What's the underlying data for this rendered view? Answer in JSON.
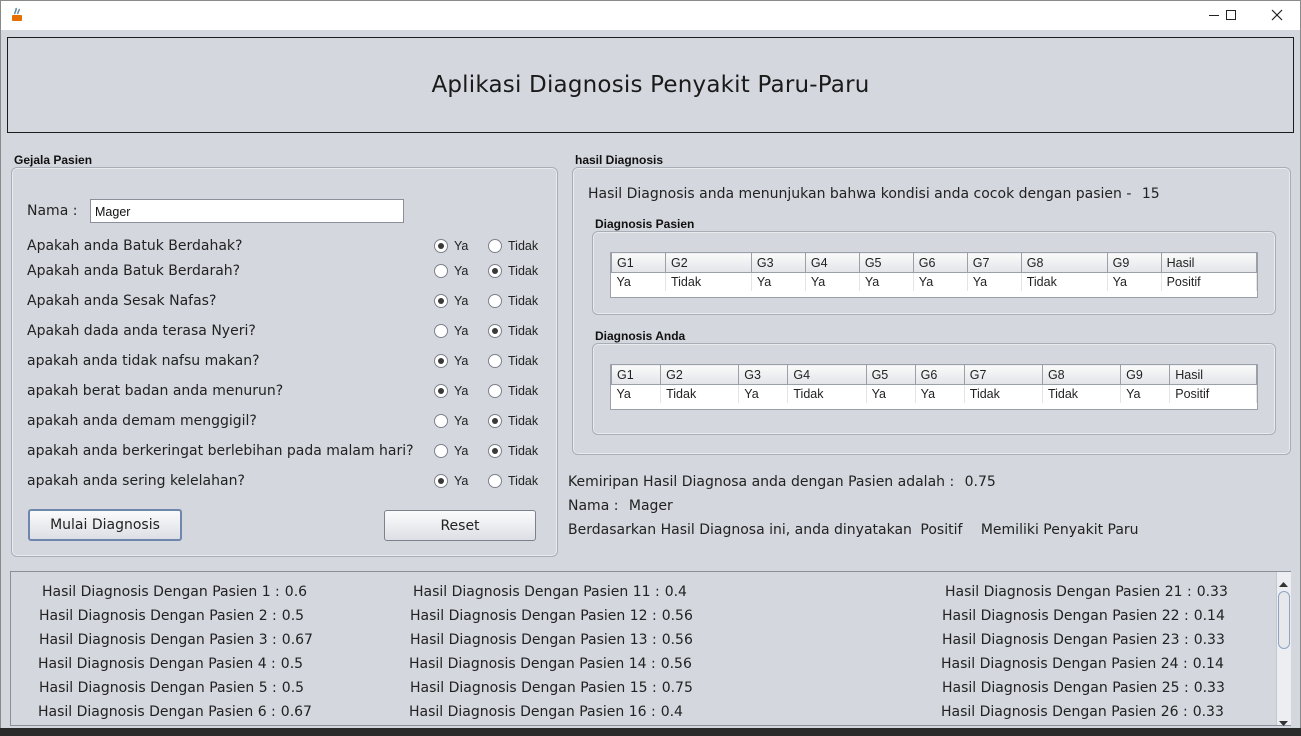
{
  "window": {
    "close_glyph": "✕"
  },
  "header": {
    "title": "Aplikasi Diagnosis Penyakit Paru-Paru"
  },
  "symptoms": {
    "group_title": "Gejala Pasien",
    "name_label": "Nama :",
    "name_value": "Mager",
    "yes_label": "Ya",
    "no_label": "Tidak",
    "questions": [
      {
        "text": "Apakah anda Batuk Berdahak?",
        "answer": "Ya"
      },
      {
        "text": "Apakah anda Batuk Berdarah?",
        "answer": "Tidak"
      },
      {
        "text": "Apakah anda Sesak Nafas?",
        "answer": "Ya"
      },
      {
        "text": "Apakah dada anda terasa Nyeri?",
        "answer": "Tidak"
      },
      {
        "text": "apakah anda tidak nafsu makan?",
        "answer": "Ya"
      },
      {
        "text": "apakah berat badan anda menurun?",
        "answer": "Ya"
      },
      {
        "text": "apakah anda demam menggigil?",
        "answer": "Tidak"
      },
      {
        "text": "apakah anda berkeringat berlebihan pada malam hari?",
        "answer": "Tidak"
      },
      {
        "text": "apakah anda sering kelelahan?",
        "answer": "Ya"
      }
    ],
    "start_button": "Mulai Diagnosis",
    "reset_button": "Reset"
  },
  "diagnosis": {
    "group_title": "hasil Diagnosis",
    "match_text": "Hasil Diagnosis anda menunjukan bahwa kondisi anda cocok dengan pasien -",
    "match_patient": "15",
    "columns": [
      "G1",
      "G2",
      "G3",
      "G4",
      "G5",
      "G6",
      "G7",
      "G8",
      "G9",
      "Hasil"
    ],
    "patient_title": "Diagnosis Pasien",
    "patient_row": [
      "Ya",
      "Tidak",
      "Ya",
      "Ya",
      "Ya",
      "Ya",
      "Ya",
      "Tidak",
      "Ya",
      "Positif"
    ],
    "yours_title": "Diagnosis Anda",
    "yours_row": [
      "Ya",
      "Tidak",
      "Ya",
      "Tidak",
      "Ya",
      "Ya",
      "Tidak",
      "Tidak",
      "Ya",
      "Positif"
    ],
    "similarity_label": "Kemiripan Hasil Diagnosa anda dengan Pasien adalah :",
    "similarity_value": "0.75",
    "name_label": "Nama :",
    "name_value": "Mager",
    "verdict_prefix": "Berdasarkan Hasil Diagnosa ini, anda dinyatakan",
    "verdict_value": "Positif",
    "verdict_suffix": "Memiliki Penyakit Paru"
  },
  "results": {
    "col1": [
      {
        "label": "Hasil Diagnosis Dengan Pasien 1 :",
        "value": "0.6"
      },
      {
        "label": "Hasil Diagnosis Dengan Pasien 2 :",
        "value": "0.5"
      },
      {
        "label": "Hasil Diagnosis Dengan Pasien 3 :",
        "value": "0.67"
      },
      {
        "label": "Hasil Diagnosis Dengan Pasien 4 :",
        "value": "0.5"
      },
      {
        "label": "Hasil Diagnosis Dengan Pasien 5 :",
        "value": "0.5"
      },
      {
        "label": "Hasil Diagnosis Dengan Pasien 6 :",
        "value": "0.67"
      }
    ],
    "col2": [
      {
        "label": "Hasil Diagnosis Dengan Pasien 11 :",
        "value": "0.4"
      },
      {
        "label": "Hasil Diagnosis Dengan Pasien 12 :",
        "value": "0.56"
      },
      {
        "label": "Hasil Diagnosis Dengan Pasien 13 :",
        "value": "0.56"
      },
      {
        "label": "Hasil Diagnosis Dengan Pasien 14 :",
        "value": "0.56"
      },
      {
        "label": "Hasil Diagnosis Dengan Pasien 15 :",
        "value": "0.75"
      },
      {
        "label": "Hasil Diagnosis Dengan Pasien 16 :",
        "value": "0.4"
      }
    ],
    "col3": [
      {
        "label": "Hasil Diagnosis Dengan Pasien 21 :",
        "value": "0.33"
      },
      {
        "label": "Hasil Diagnosis Dengan Pasien 22 :",
        "value": "0.14"
      },
      {
        "label": "Hasil Diagnosis Dengan Pasien 23 :",
        "value": "0.33"
      },
      {
        "label": "Hasil Diagnosis Dengan Pasien 24 :",
        "value": "0.14"
      },
      {
        "label": "Hasil Diagnosis Dengan Pasien 25 :",
        "value": "0.33"
      },
      {
        "label": "Hasil Diagnosis Dengan Pasien 26 :",
        "value": "0.33"
      }
    ]
  }
}
